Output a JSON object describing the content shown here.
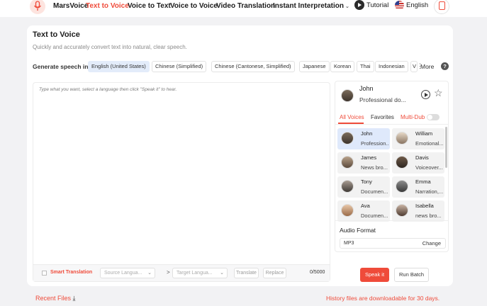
{
  "nav": {
    "brand": "MarsVoice",
    "items": [
      "Text to Voice",
      "Voice to Text",
      "Voice to Voice",
      "Video Translation",
      "Instant Interpretation"
    ],
    "active_item": "Text to Voice",
    "tutorial": "Tutorial",
    "language": "English"
  },
  "page": {
    "title": "Text to Voice",
    "subtitle": "Quickly and accurately convert text into natural, clear speech."
  },
  "generate": {
    "label": "Generate speech in",
    "languages": [
      "English (United States)",
      "Chinese (Simplified)",
      "Chinese (Cantonese, Simplified)",
      "Japanese",
      "Korean",
      "Thai",
      "Indonesian",
      "V"
    ],
    "selected": "English (United States)",
    "more": "More",
    "help": "?"
  },
  "editor": {
    "placeholder": "Type what you want, select a language then click \"Speak it\" to hear.",
    "smart_translation": "Smart Translation",
    "source_language": "Source Langua...",
    "target_language": "Target Langua...",
    "arrow": ">",
    "translate": "Translate",
    "replace": "Replace",
    "count": "0/5000"
  },
  "voice_panel": {
    "selected": {
      "name": "John",
      "description": "Professional do..."
    },
    "tabs": [
      "All Voices",
      "Favorites",
      "Multi-Dub"
    ],
    "active_tab": "All Voices",
    "voices": [
      {
        "name": "John",
        "description": "Profession..."
      },
      {
        "name": "William",
        "description": "Emotional..."
      },
      {
        "name": "James",
        "description": "News bro..."
      },
      {
        "name": "Davis",
        "description": "Voiceover..."
      },
      {
        "name": "Tony",
        "description": "Documen..."
      },
      {
        "name": "Emma",
        "description": "Narration,..."
      },
      {
        "name": "Ava",
        "description": "Documen..."
      },
      {
        "name": "Isabella",
        "description": "news bro..."
      }
    ],
    "audio_format_label": "Audio Format",
    "audio_format": "MP3",
    "change": "Change"
  },
  "actions": {
    "speak": "Speak it",
    "batch": "Run Batch"
  },
  "footer": {
    "recent_files": "Recent Files",
    "history_note": "History files are downloadable for 30 days."
  },
  "colors": {
    "accent": "#ef4b3a",
    "selected_bg": "#dfe9fb",
    "page_bg": "#f2f2f4"
  },
  "icons": [
    "mic-logo-icon",
    "play-circle-icon",
    "us-flag-icon",
    "user-icon",
    "star-icon",
    "download-icon",
    "help-icon"
  ]
}
